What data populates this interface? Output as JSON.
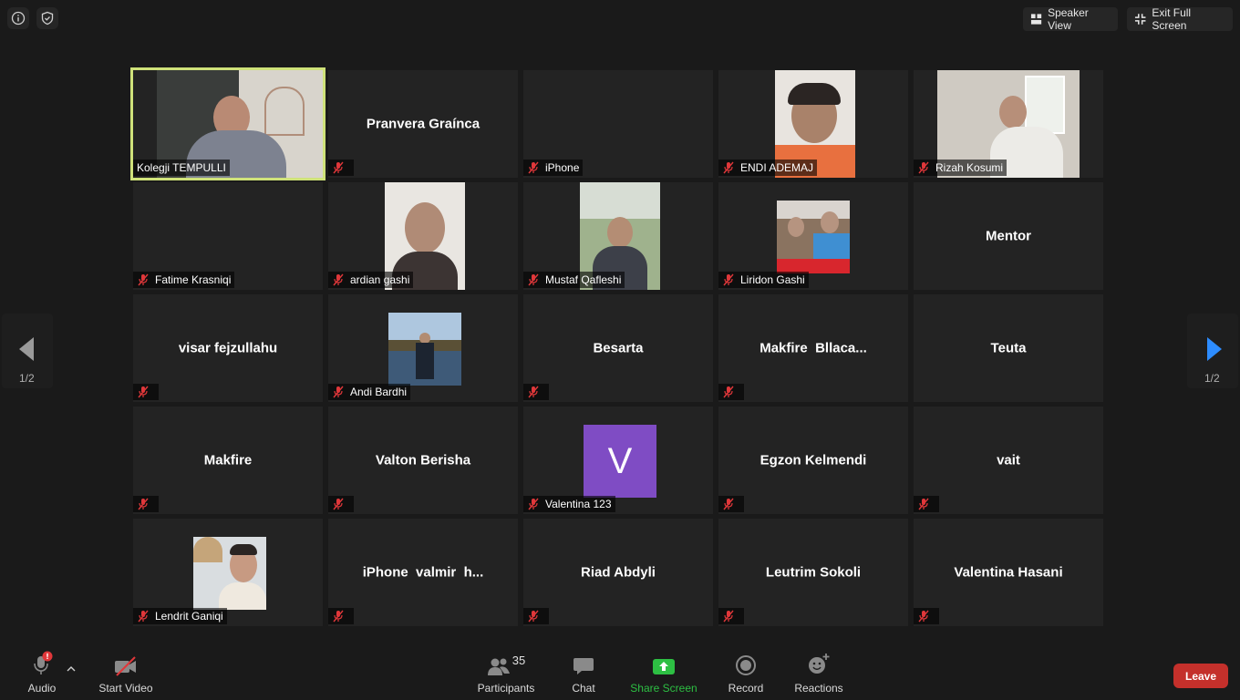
{
  "top": {
    "view_label": "Speaker View",
    "exit_label": "Exit Full Screen"
  },
  "tiles": [
    {
      "label": "Kolegji TEMPULLI",
      "display": "",
      "active": true,
      "photo": "video"
    },
    {
      "label": "",
      "display": "Pranvera Graínca",
      "photo": ""
    },
    {
      "label": "iPhone",
      "display": "",
      "photo": ""
    },
    {
      "label": "ENDI ADEMAJ",
      "display": "",
      "photo": "photo"
    },
    {
      "label": "Rizah Kosumi",
      "display": "",
      "photo": "photo"
    },
    {
      "label": "Fatime Krasniqi",
      "display": "",
      "photo": ""
    },
    {
      "label": "ardian gashi",
      "display": "",
      "photo": "photo"
    },
    {
      "label": "Mustaf Qafleshi",
      "display": "",
      "photo": "photo"
    },
    {
      "label": "Liridon Gashi",
      "display": "",
      "photo": "photo"
    },
    {
      "label": "",
      "display": "Mentor",
      "photo": ""
    },
    {
      "label": "",
      "display": "visar fejzullahu",
      "photo": ""
    },
    {
      "label": "Andi Bardhi",
      "display": "",
      "photo": "photo"
    },
    {
      "label": "",
      "display": "Besarta",
      "photo": ""
    },
    {
      "label": "",
      "display": "Makfire  Bllaca...",
      "photo": ""
    },
    {
      "label": "",
      "display": "Teuta",
      "photo": ""
    },
    {
      "label": "",
      "display": "Makfire",
      "photo": ""
    },
    {
      "label": "",
      "display": "Valton Berisha",
      "photo": ""
    },
    {
      "label": "Valentina 123",
      "display": "",
      "photo": "avatar",
      "avatar_letter": "V"
    },
    {
      "label": "",
      "display": "Egzon Kelmendi",
      "photo": ""
    },
    {
      "label": "",
      "display": "vait",
      "photo": ""
    },
    {
      "label": "Lendrit Ganiqi",
      "display": "",
      "photo": "photo"
    },
    {
      "label": "",
      "display": "iPhone  valmir  h...",
      "photo": ""
    },
    {
      "label": "",
      "display": "Riad Abdyli",
      "photo": ""
    },
    {
      "label": "",
      "display": "Leutrim Sokoli",
      "photo": ""
    },
    {
      "label": "",
      "display": "Valentina Hasani",
      "photo": ""
    }
  ],
  "paging": {
    "left": "1/2",
    "right": "1/2"
  },
  "toolbar": {
    "audio": "Audio",
    "video": "Start Video",
    "participants": "Participants",
    "participants_count": "35",
    "chat": "Chat",
    "share": "Share Screen",
    "record": "Record",
    "reactions": "Reactions",
    "leave": "Leave"
  },
  "colors": {
    "active_border": "#cfe27a",
    "share_green": "#2dbf43",
    "leave_red": "#c4302b",
    "avatar_purple": "#7f4cc4"
  }
}
